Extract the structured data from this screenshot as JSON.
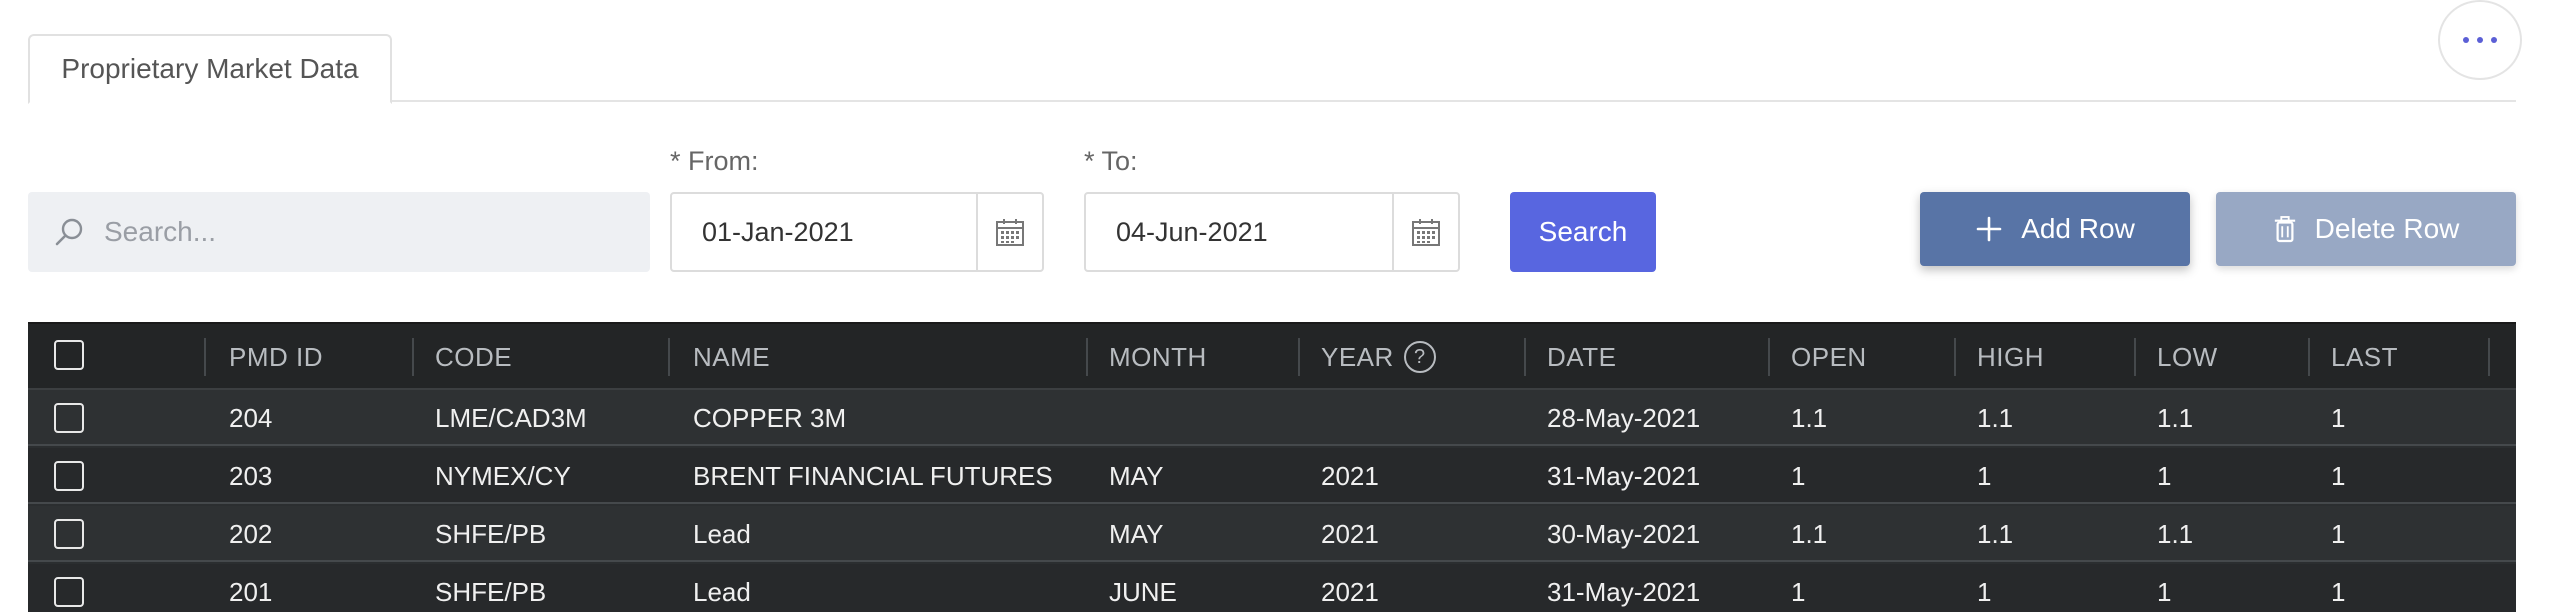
{
  "tabs": [
    {
      "label": "Proprietary Market Data"
    }
  ],
  "search": {
    "placeholder": "Search..."
  },
  "from": {
    "label": "* From:",
    "value": "01-Jan-2021"
  },
  "to": {
    "label": "* To:",
    "value": "04-Jun-2021"
  },
  "buttons": {
    "search": "Search",
    "add_row": "Add Row",
    "delete_row": "Delete Row"
  },
  "colors": {
    "accent": "#5866e0",
    "add": "#5874a6",
    "delete": "#98a8c4",
    "grid_bg": "#2b2e30"
  },
  "table": {
    "columns": [
      "PMD ID",
      "CODE",
      "NAME",
      "MONTH",
      "YEAR",
      "DATE",
      "OPEN",
      "HIGH",
      "LOW",
      "LAST"
    ],
    "year_help": "?",
    "rows": [
      {
        "pmd_id": "204",
        "code": "LME/CAD3M",
        "name": "COPPER 3M",
        "month": "",
        "year": "",
        "date": "28-May-2021",
        "open": "1.1",
        "high": "1.1",
        "low": "1.1",
        "last": "1"
      },
      {
        "pmd_id": "203",
        "code": "NYMEX/CY",
        "name": "BRENT FINANCIAL FUTURES",
        "month": "MAY",
        "year": "2021",
        "date": "31-May-2021",
        "open": "1",
        "high": "1",
        "low": "1",
        "last": "1"
      },
      {
        "pmd_id": "202",
        "code": "SHFE/PB",
        "name": "Lead",
        "month": "MAY",
        "year": "2021",
        "date": "30-May-2021",
        "open": "1.1",
        "high": "1.1",
        "low": "1.1",
        "last": "1"
      },
      {
        "pmd_id": "201",
        "code": "SHFE/PB",
        "name": "Lead",
        "month": "JUNE",
        "year": "2021",
        "date": "31-May-2021",
        "open": "1",
        "high": "1",
        "low": "1",
        "last": "1"
      }
    ]
  }
}
